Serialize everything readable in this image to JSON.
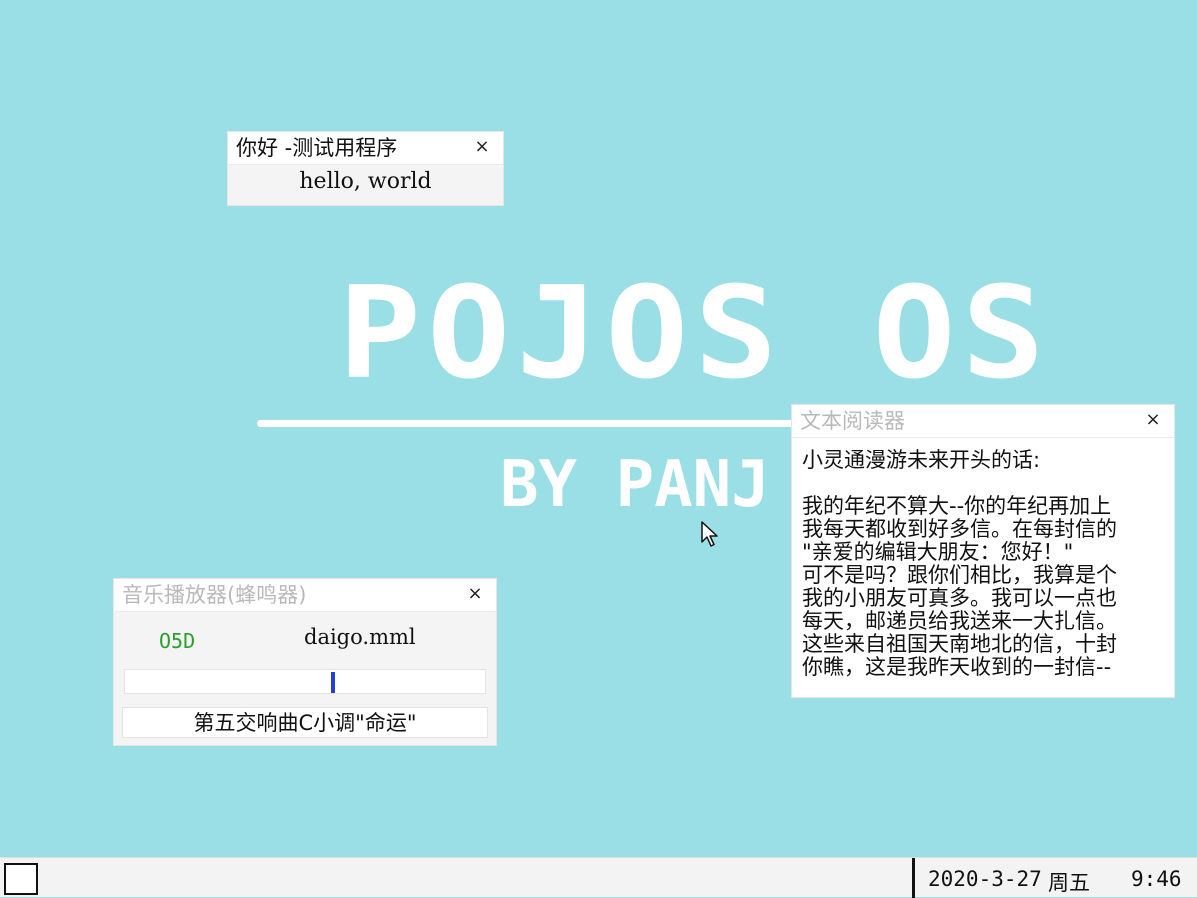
{
  "wallpaper": {
    "title": "POJOS OS",
    "subtitle": "BY PANJ",
    "background_color": "#9adfe6"
  },
  "windows": {
    "hello": {
      "title": "你好 -测试用程序",
      "close_label": "×",
      "body": "hello, world"
    },
    "music": {
      "title": "音乐播放器(蜂鸣器)",
      "close_label": "×",
      "note": "O5D",
      "file": "daigo.mml",
      "progress": 0.58,
      "song": "第五交响曲C小调\"命运\"",
      "accent_color": "#1f3fd8",
      "note_color": "#2aa12a"
    },
    "reader": {
      "title": "文本阅读器",
      "close_label": "×",
      "lines": [
        "小灵通漫游未来开头的话:",
        "",
        "我的年纪不算大--你的年纪再加上",
        "我每天都收到好多信。在每封信的",
        "\"亲爱的编辑大朋友：您好！\"",
        "可不是吗？跟你们相比，我算是个",
        "我的小朋友可真多。我可以一点也",
        "每天，邮递员给我送来一大扎信。",
        "这些来自祖国天南地北的信，十封",
        "你瞧，这是我昨天收到的一封信--"
      ]
    }
  },
  "taskbar": {
    "date": "2020-3-27",
    "weekday": "周五",
    "time": "9:46"
  },
  "icons": {
    "start": "start-square-icon",
    "cursor": "mouse-pointer-icon",
    "close": "close-icon"
  }
}
